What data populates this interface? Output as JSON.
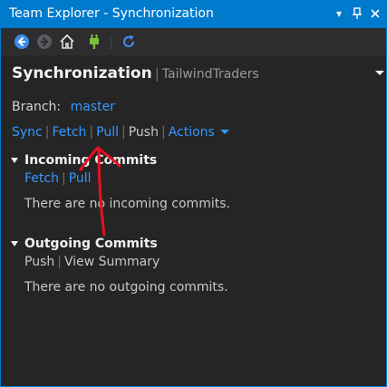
{
  "window": {
    "title": "Team Explorer - Synchronization",
    "buttons": {
      "dropdown_icon": "dropdown-icon",
      "pin_icon": "pin-icon",
      "close_icon": "close-icon"
    }
  },
  "toolbar": {
    "icons": [
      "back-icon",
      "forward-icon",
      "home-icon",
      "connect-icon",
      "refresh-icon"
    ]
  },
  "header": {
    "title": "Synchronization",
    "separator": "|",
    "repository": "TailwindTraders"
  },
  "branch": {
    "label": "Branch:",
    "value": "master"
  },
  "actions_bar": {
    "sync": "Sync",
    "fetch": "Fetch",
    "pull": "Pull",
    "push": "Push",
    "actions": "Actions",
    "separator": "|"
  },
  "incoming": {
    "title": "Incoming Commits",
    "fetch": "Fetch",
    "pull": "Pull",
    "separator": "|",
    "empty_message": "There are no incoming commits."
  },
  "outgoing": {
    "title": "Outgoing Commits",
    "push": "Push",
    "view_summary": "View Summary",
    "separator": "|",
    "empty_message": "There are no outgoing commits."
  },
  "colors": {
    "accent": "#007acc",
    "link": "#3399ff",
    "background": "#252526",
    "annotation": "#e81123"
  }
}
